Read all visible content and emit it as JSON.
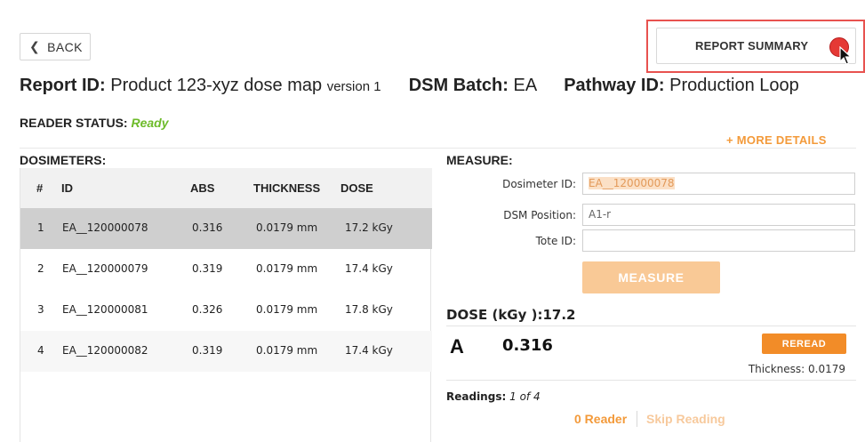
{
  "nav": {
    "back_label": "BACK"
  },
  "summary": {
    "button_label": "REPORT SUMMARY"
  },
  "report": {
    "report_id_label": "Report ID:",
    "report_id_value": "Product 123-xyz dose map",
    "version": "version 1",
    "dsm_batch_label": "DSM Batch:",
    "dsm_batch_value": "EA",
    "pathway_id_label": "Pathway ID:",
    "pathway_id_value": "Production Loop"
  },
  "reader_status": {
    "label": "READER STATUS:",
    "value": "Ready"
  },
  "more_details": "+ MORE DETAILS",
  "dosimeters": {
    "title": "DOSIMETERS:",
    "columns": {
      "num": "#",
      "id": "ID",
      "abs": "ABS",
      "thickness": "THICKNESS",
      "dose": "DOSE"
    },
    "rows": [
      {
        "num": "1",
        "id": "EA__120000078",
        "abs": "0.316",
        "thickness": "0.0179 mm",
        "dose": "17.2 kGy"
      },
      {
        "num": "2",
        "id": "EA__120000079",
        "abs": "0.319",
        "thickness": "0.0179 mm",
        "dose": "17.4 kGy"
      },
      {
        "num": "3",
        "id": "EA__120000081",
        "abs": "0.326",
        "thickness": "0.0179 mm",
        "dose": "17.8 kGy"
      },
      {
        "num": "4",
        "id": "EA__120000082",
        "abs": "0.319",
        "thickness": "0.0179 mm",
        "dose": "17.4 kGy"
      }
    ]
  },
  "measure": {
    "title": "MEASURE:",
    "dosimeter_id_label": "Dosimeter ID:",
    "dosimeter_id_value": "EA__120000078",
    "dsm_position_label": "DSM Position:",
    "dsm_position_value": "A1-r",
    "tote_id_label": "Tote ID:",
    "tote_id_value": "",
    "button_label": "MEASURE"
  },
  "dose": {
    "title": "DOSE (kGy ):17.2",
    "reading_letter": "A",
    "reading_value": "0.316",
    "reread_label": "REREAD",
    "thickness_text": "Thickness: 0.0179"
  },
  "readings": {
    "label": "Readings:",
    "current": "1",
    "of_word": "of",
    "total": "4",
    "reader_link": "0 Reader",
    "skip_link": "Skip Reading"
  },
  "colors": {
    "accent_orange": "#f28c28",
    "ready_green": "#6dbb2a",
    "highlight_red": "#e8524f",
    "selected_row": "#cfcfcf"
  }
}
